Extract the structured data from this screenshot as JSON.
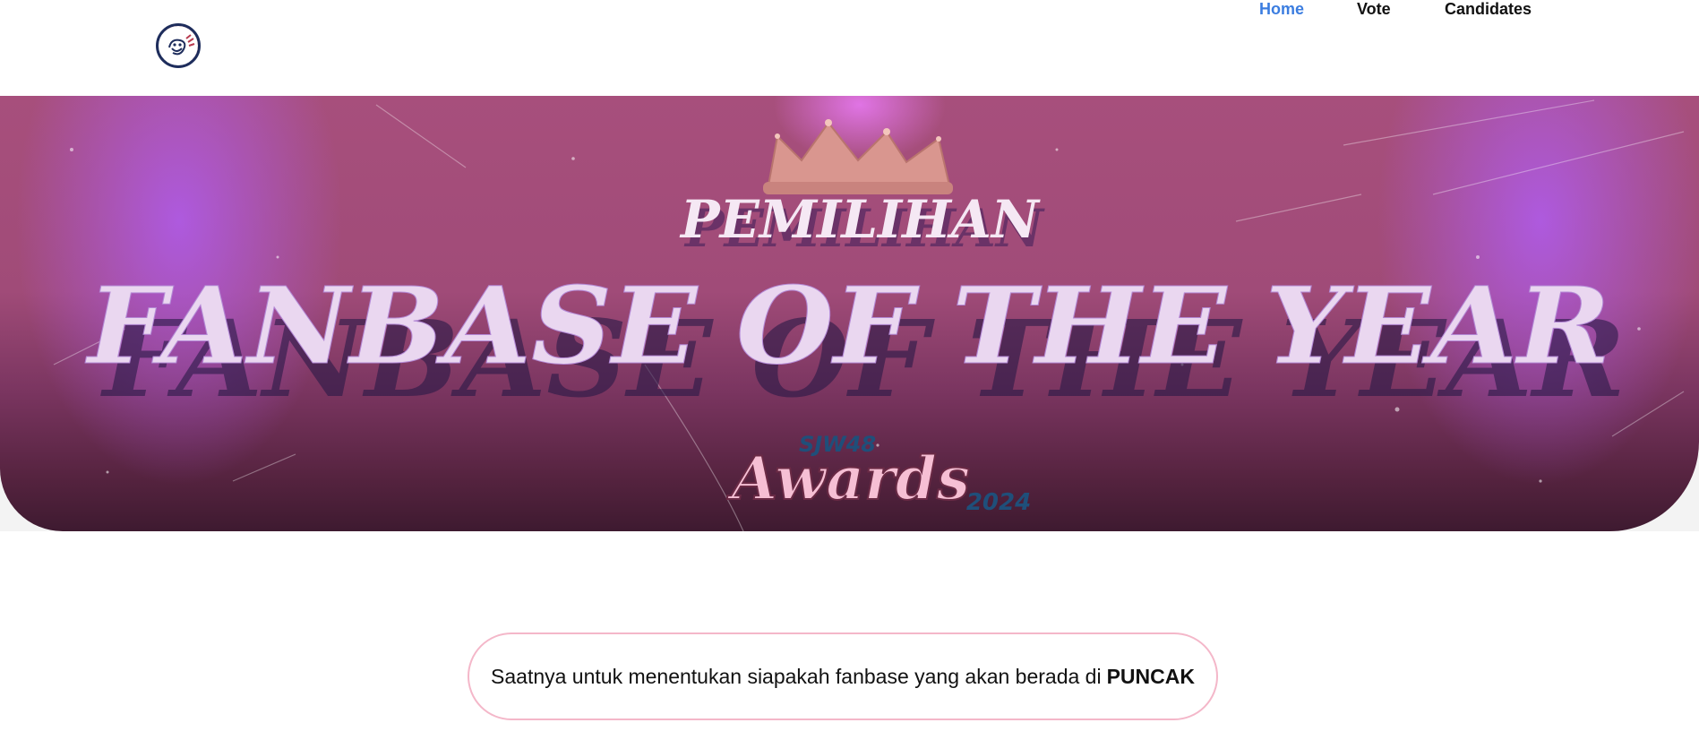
{
  "header": {
    "logo_icon": "fanbase-logo-icon",
    "nav": [
      {
        "label": "Home",
        "active": true
      },
      {
        "label": "Vote",
        "active": false
      },
      {
        "label": "Candidates",
        "active": false
      }
    ],
    "accent_color": "#3b7de0"
  },
  "hero": {
    "kicker": "PEMILIHAN",
    "title": "FANBASE OF THE YEAR",
    "badge_top": "SJW48",
    "badge_main": "Awards",
    "badge_year": "2024",
    "crown_icon": "crown-icon"
  },
  "tagline": {
    "text": "Saatnya untuk menentukan siapakah fanbase yang akan berada di",
    "emphasis": "PUNCAK",
    "border_color": "#f4b7c9"
  }
}
